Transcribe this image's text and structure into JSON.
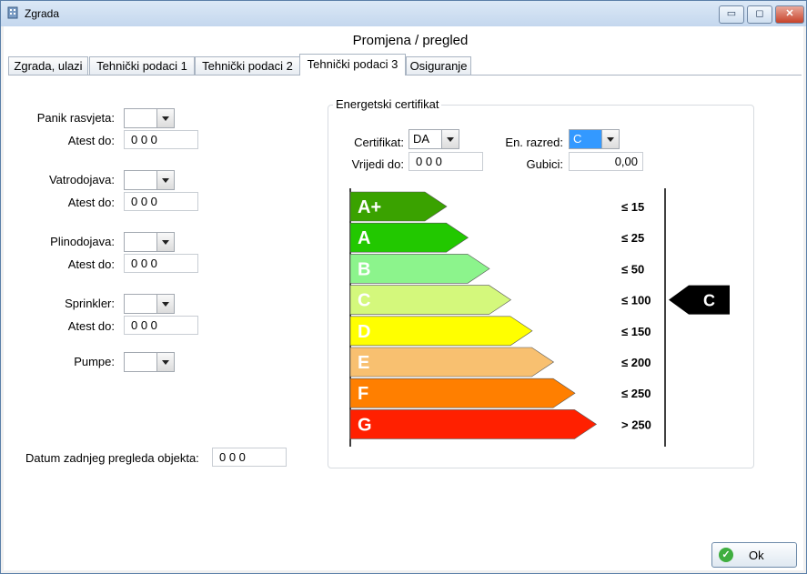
{
  "window": {
    "title": "Zgrada",
    "minimize_glyph": "▭",
    "maximize_glyph": "◻",
    "close_glyph": "✕"
  },
  "heading": "Promjena / pregled",
  "tabs": [
    {
      "label": "Zgrada, ulazi",
      "active": false
    },
    {
      "label": "Tehnički podaci 1",
      "active": false
    },
    {
      "label": "Tehnički podaci 2",
      "active": false
    },
    {
      "label": "Tehnički podaci 3",
      "active": true
    },
    {
      "label": "Osiguranje",
      "active": false
    }
  ],
  "left": {
    "panik": {
      "label": "Panik rasvjeta:",
      "value": "",
      "atest_label": "Atest do:",
      "atest_value": "0 0 0"
    },
    "vatro": {
      "label": "Vatrodojava:",
      "value": "",
      "atest_label": "Atest do:",
      "atest_value": "0 0 0"
    },
    "plino": {
      "label": "Plinodojava:",
      "value": "",
      "atest_label": "Atest do:",
      "atest_value": "0 0 0"
    },
    "sprinkler": {
      "label": "Sprinkler:",
      "value": "",
      "atest_label": "Atest do:",
      "atest_value": "0 0 0"
    },
    "pumpe": {
      "label": "Pumpe:",
      "value": ""
    },
    "datum": {
      "label": "Datum zadnjeg pregleda objekta:",
      "value": "0 0 0"
    }
  },
  "cert": {
    "group_title": "Energetski certifikat",
    "certifikat_label": "Certifikat:",
    "certifikat_value": "DA",
    "razred_label": "En. razred:",
    "razred_value": "C",
    "vrijedi_label": "Vrijedi do:",
    "vrijedi_value": "0 0 0",
    "gubici_label": "Gubici:",
    "gubici_value": "0,00"
  },
  "energy_scale": {
    "classes": [
      {
        "label": "A+",
        "limit": "≤ 15",
        "color": "#3aa200"
      },
      {
        "label": "A",
        "limit": "≤ 25",
        "color": "#22c800"
      },
      {
        "label": "B",
        "limit": "≤ 50",
        "color": "#8cf48c"
      },
      {
        "label": "C",
        "limit": "≤ 100",
        "color": "#d4f87c"
      },
      {
        "label": "D",
        "limit": "≤ 150",
        "color": "#ffff00"
      },
      {
        "label": "E",
        "limit": "≤ 200",
        "color": "#f8c070"
      },
      {
        "label": "F",
        "limit": "≤ 250",
        "color": "#ff7f00"
      },
      {
        "label": "G",
        "limit": "> 250",
        "color": "#ff2000"
      }
    ],
    "selected_marker": "C",
    "selected_index": 3
  },
  "ok_button": {
    "label": "Ok",
    "icon": "check-icon",
    "icon_glyph": "✓"
  }
}
